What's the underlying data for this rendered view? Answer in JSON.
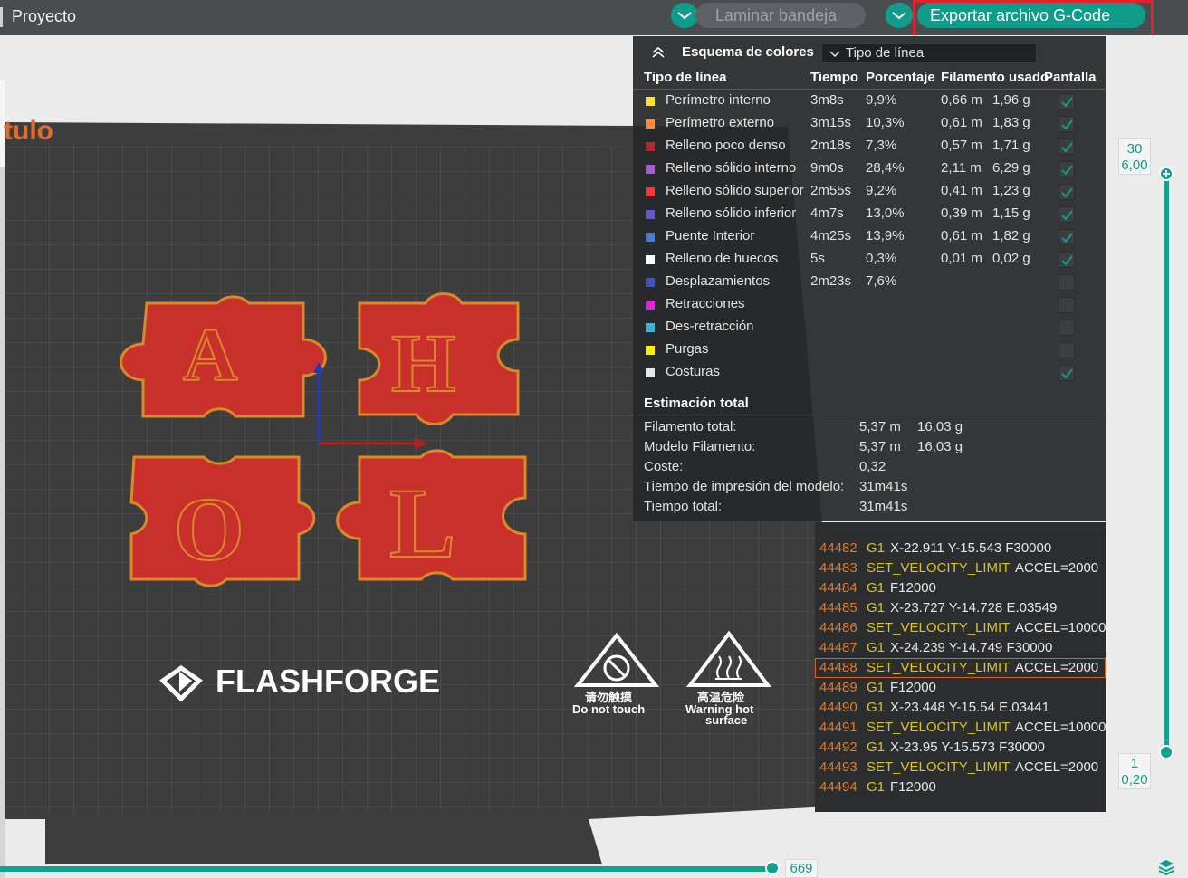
{
  "topbar": {
    "title": "Proyecto",
    "slice_label": "Laminar bandeja",
    "export_label": "Exportar archivo G-Code"
  },
  "plate": {
    "partial_label": "tulo",
    "brand": "FLASHFORGE",
    "warn_touch_cn": "请勿触摸",
    "warn_touch_en": "Do not touch",
    "warn_hot_cn": "高温危险",
    "warn_hot_en1": "Warning hot",
    "warn_hot_en2": "surface",
    "letters": [
      "A",
      "H",
      "O",
      "L"
    ]
  },
  "stats": {
    "scheme_label": "Esquema de colores",
    "scheme_value": "Tipo de línea",
    "headers": [
      "Tipo de línea",
      "Tiempo",
      "Porcentaje",
      "Filamento usado",
      "Pantalla"
    ],
    "rows": [
      {
        "name": "Perímetro interno",
        "time": "3m8s",
        "pct": "9,9%",
        "len": "0,66 m",
        "weight": "1,96 g",
        "color": "#ffe234",
        "checked": true
      },
      {
        "name": "Perímetro externo",
        "time": "3m15s",
        "pct": "10,3%",
        "len": "0,61 m",
        "weight": "1,83 g",
        "color": "#ff8a3c",
        "checked": true
      },
      {
        "name": "Relleno poco denso",
        "time": "2m18s",
        "pct": "7,3%",
        "len": "0,57 m",
        "weight": "1,71 g",
        "color": "#b12a2f",
        "checked": true
      },
      {
        "name": "Relleno sólido interno",
        "time": "9m0s",
        "pct": "28,4%",
        "len": "2,11 m",
        "weight": "6,29 g",
        "color": "#a65ecf",
        "checked": true
      },
      {
        "name": "Relleno sólido superior",
        "time": "2m55s",
        "pct": "9,2%",
        "len": "0,41 m",
        "weight": "1,23 g",
        "color": "#f03a3a",
        "checked": true
      },
      {
        "name": "Relleno sólido inferior",
        "time": "4m7s",
        "pct": "13,0%",
        "len": "0,39 m",
        "weight": "1,15 g",
        "color": "#6956c8",
        "checked": true
      },
      {
        "name": "Puente Interior",
        "time": "4m25s",
        "pct": "13,9%",
        "len": "0,61 m",
        "weight": "1,82 g",
        "color": "#4a7fc4",
        "checked": true
      },
      {
        "name": "Relleno de huecos",
        "time": "5s",
        "pct": "0,3%",
        "len": "0,01 m",
        "weight": "0,02 g",
        "color": "#ffffff",
        "checked": true
      },
      {
        "name": "Desplazamientos",
        "time": "2m23s",
        "pct": "7,6%",
        "len": "",
        "weight": "",
        "color": "#4355b8",
        "checked": false
      },
      {
        "name": "Retracciones",
        "time": "",
        "pct": "",
        "len": "",
        "weight": "",
        "color": "#e024d9",
        "checked": false
      },
      {
        "name": "Des-retracción",
        "time": "",
        "pct": "",
        "len": "",
        "weight": "",
        "color": "#3bb3d9",
        "checked": false
      },
      {
        "name": "Purgas",
        "time": "",
        "pct": "",
        "len": "",
        "weight": "",
        "color": "#ffee00",
        "checked": false
      },
      {
        "name": "Costuras",
        "time": "",
        "pct": "",
        "len": "",
        "weight": "",
        "color": "#e6e6e6",
        "checked": true
      }
    ],
    "estimate_title": "Estimación total",
    "estimates": [
      {
        "label": "Filamento total:",
        "v1": "5,37 m",
        "v2": "16,03 g"
      },
      {
        "label": "Modelo Filamento:",
        "v1": "5,37 m",
        "v2": "16,03 g"
      },
      {
        "label": "Coste:",
        "v1": "0,32",
        "v2": ""
      },
      {
        "label": "Tiempo de impresión del modelo:",
        "v1": "31m41s",
        "v2": ""
      },
      {
        "label": "Tiempo total:",
        "v1": "31m41s",
        "v2": ""
      }
    ]
  },
  "gcode": {
    "selected_index": 6,
    "lines": [
      {
        "n": "44482",
        "cmd": "G1",
        "args": "X-22.911 Y-15.543 F30000"
      },
      {
        "n": "44483",
        "cmd": "SET_VELOCITY_LIMIT",
        "args": "ACCEL=2000"
      },
      {
        "n": "44484",
        "cmd": "G1",
        "args": "F12000"
      },
      {
        "n": "44485",
        "cmd": "G1",
        "args": "X-23.727 Y-14.728 E.03549"
      },
      {
        "n": "44486",
        "cmd": "SET_VELOCITY_LIMIT",
        "args": "ACCEL=10000"
      },
      {
        "n": "44487",
        "cmd": "G1",
        "args": "X-24.239 Y-14.749 F30000"
      },
      {
        "n": "44488",
        "cmd": "SET_VELOCITY_LIMIT",
        "args": "ACCEL=2000"
      },
      {
        "n": "44489",
        "cmd": "G1",
        "args": "F12000"
      },
      {
        "n": "44490",
        "cmd": "G1",
        "args": "X-23.448 Y-15.54 E.03441"
      },
      {
        "n": "44491",
        "cmd": "SET_VELOCITY_LIMIT",
        "args": "ACCEL=10000"
      },
      {
        "n": "44492",
        "cmd": "G1",
        "args": "X-23.95 Y-15.573 F30000"
      },
      {
        "n": "44493",
        "cmd": "SET_VELOCITY_LIMIT",
        "args": "ACCEL=2000"
      },
      {
        "n": "44494",
        "cmd": "G1",
        "args": "F12000"
      }
    ]
  },
  "layer_slider": {
    "top_layer": "30",
    "top_height": "6,00",
    "bottom_layer": "1",
    "bottom_height": "0,20"
  },
  "move_slider": {
    "value": "669"
  },
  "colors": {
    "accent": "#0f9c8a",
    "highlight": "#e0232b",
    "plate": "#3d3d3d",
    "part": "#c9302c"
  }
}
